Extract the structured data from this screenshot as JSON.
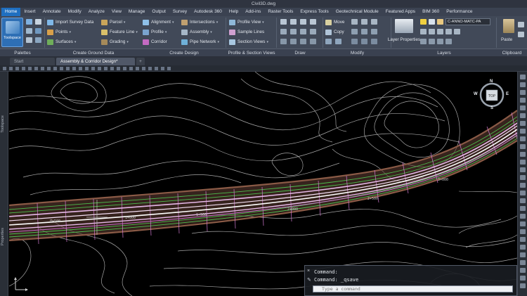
{
  "window": {
    "title": "Civil3D.dwg"
  },
  "menu": {
    "tabs": [
      "Home",
      "Insert",
      "Annotate",
      "Modify",
      "Analyze",
      "View",
      "Manage",
      "Output",
      "Survey",
      "Autodesk 360",
      "Help",
      "Add-ins",
      "Raster Tools",
      "Express Tools",
      "Geotechnical Module",
      "Featured Apps",
      "BIM 360",
      "Performance"
    ]
  },
  "ribbon": {
    "big_button": "Toolspace",
    "group1": {
      "import": "Import Survey Data",
      "points": "Points",
      "surfaces": "Surfaces"
    },
    "group2": {
      "parcel": "Parcel",
      "feature_line": "Feature Line",
      "grading": "Grading"
    },
    "group3": {
      "alignment": "Alignment",
      "profile": "Profile",
      "corridor": "Corridor"
    },
    "group4": {
      "intersections": "Intersections",
      "assembly": "Assembly",
      "pipe_network": "Pipe Network"
    },
    "group5": {
      "profile_view": "Profile View",
      "sample_lines": "Sample Lines",
      "section_views": "Section Views"
    },
    "modify": {
      "move": "Move",
      "copy": "Copy"
    },
    "layer_props": "Layer Properties",
    "layer_value": "C-ANNO-MATC-PA",
    "paste": "Paste",
    "panels": [
      "Palettes",
      "Create Ground Data",
      "Create Design",
      "Profile & Section Views",
      "Draw",
      "Modify",
      "Layers",
      "Clipboard"
    ]
  },
  "doc_tabs": {
    "start": "Start",
    "active": "Assembly & Corridor Design*"
  },
  "side": {
    "toolspace": "Toolspace",
    "properties": "Properties"
  },
  "compass": {
    "n": "N",
    "w": "W",
    "e": "E",
    "s": "S",
    "top": "TOP"
  },
  "command": {
    "line1": "Command:",
    "line2": "Command: _qsave",
    "prompt": "Type a command",
    "close": "×"
  },
  "colors": {
    "accent": "#1f6fc0",
    "road": "#e6b8e8",
    "edge": "#4dbd4d",
    "contour": "#bfbfbf",
    "grading": "#8a5a46"
  }
}
